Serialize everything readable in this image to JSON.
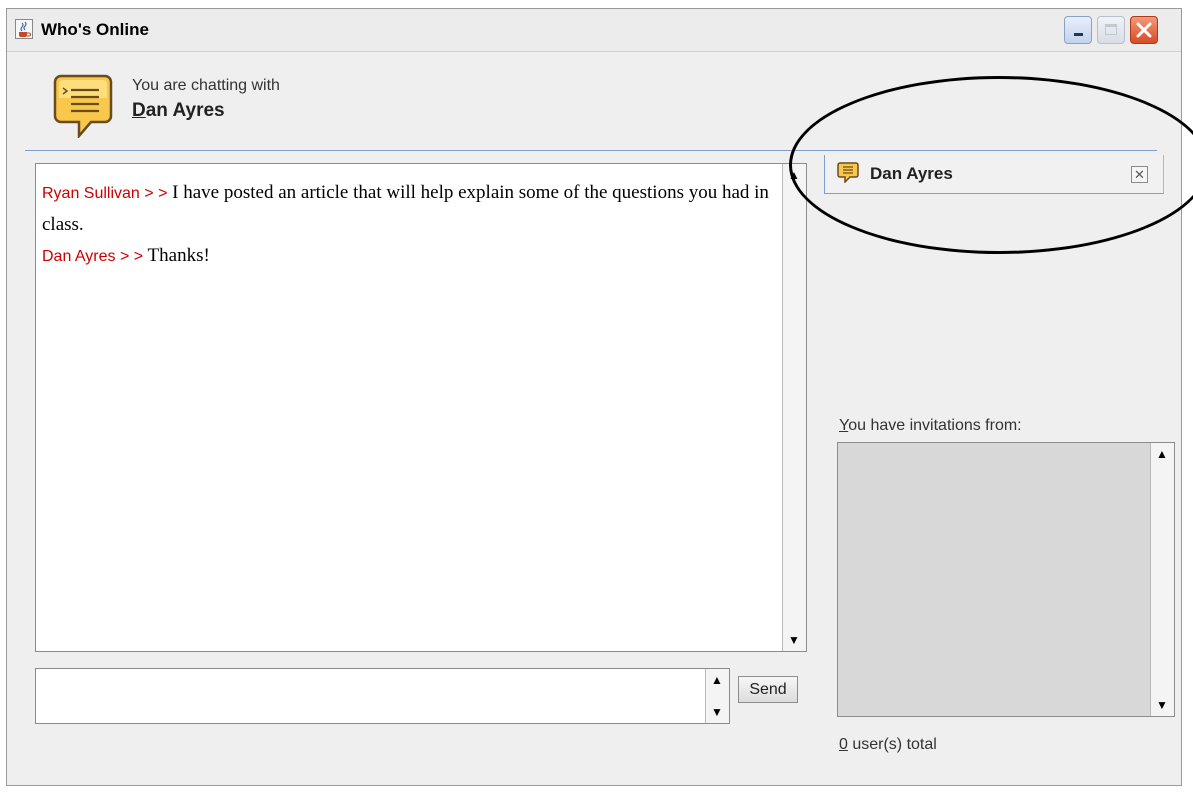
{
  "window": {
    "title": "Who's Online",
    "buttons": [
      "minimize",
      "maximize",
      "close"
    ]
  },
  "header": {
    "chatting_label": "You are chatting with",
    "contact_name_first": "D",
    "contact_name_rest": "an Ayres"
  },
  "tab": {
    "label": "Dan Ayres",
    "close_glyph": "✕"
  },
  "messages": [
    {
      "sender": "Ryan Sullivan > >",
      "text": "I have posted an article that will help explain some of the questions you had in class."
    },
    {
      "sender": "Dan Ayres > >",
      "text": "Thanks!"
    }
  ],
  "composer": {
    "value": "",
    "send_label": "Send"
  },
  "invitations": {
    "label_first": "Y",
    "label_rest": "ou have invitations from:",
    "items": [],
    "total_count": "0",
    "total_suffix": " user(s) total"
  },
  "scroll": {
    "up": "▲",
    "down": "▼"
  },
  "colors": {
    "sender": "#cc0000",
    "divider": "#7f9dcf",
    "close_button": "#d94a22",
    "annotation": "#000000"
  },
  "icons": [
    "java-cup-icon",
    "chat-bubble-icon",
    "close-icon",
    "scroll-up-icon",
    "scroll-down-icon"
  ]
}
